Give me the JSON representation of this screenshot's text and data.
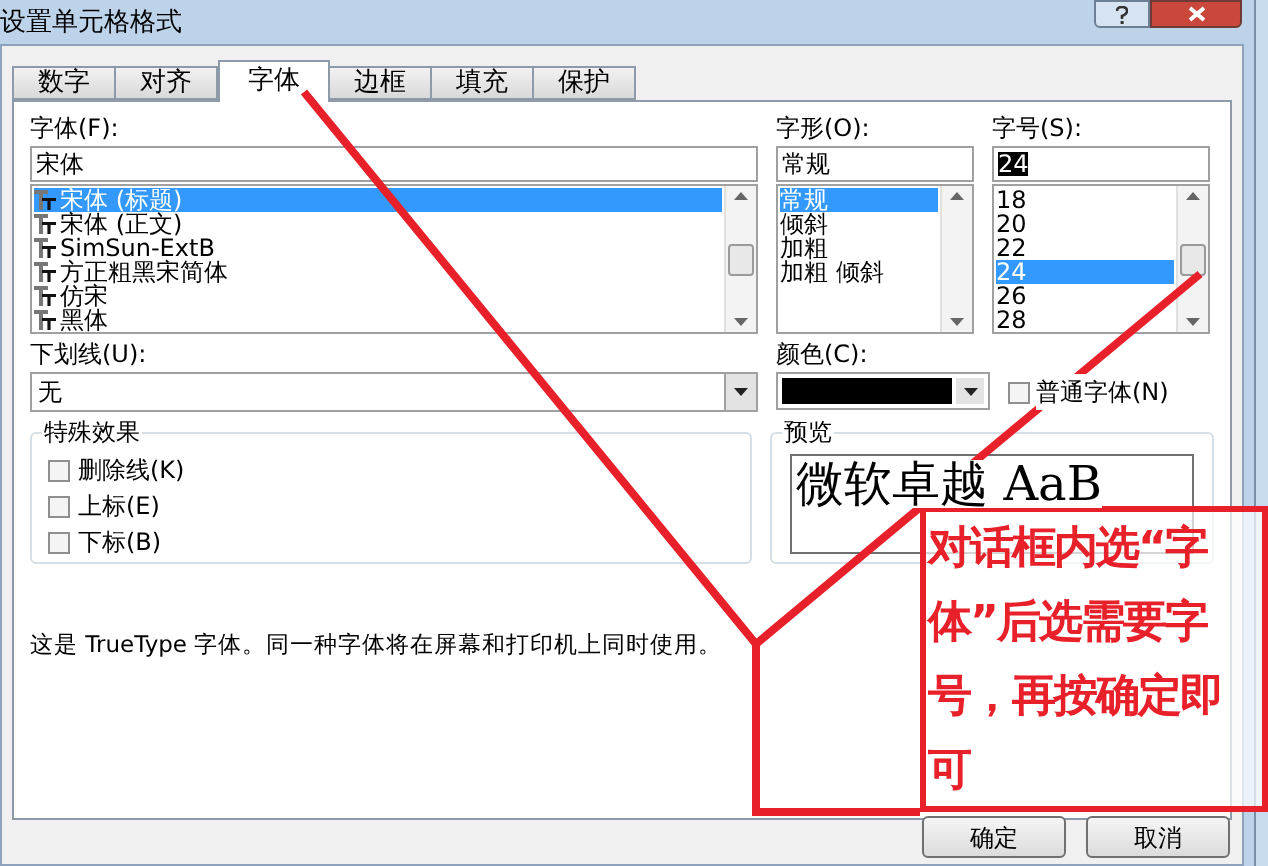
{
  "window": {
    "title": "设置单元格格式"
  },
  "tabs": [
    {
      "label": "数字",
      "selected": false
    },
    {
      "label": "对齐",
      "selected": false
    },
    {
      "label": "字体",
      "selected": true
    },
    {
      "label": "边框",
      "selected": false
    },
    {
      "label": "填充",
      "selected": false
    },
    {
      "label": "保护",
      "selected": false
    }
  ],
  "font": {
    "label": "字体(F):",
    "value": "宋体",
    "items": [
      {
        "label": "宋体 (标题)",
        "selected": true
      },
      {
        "label": "宋体 (正文)",
        "selected": false
      },
      {
        "label": "SimSun-ExtB",
        "selected": false
      },
      {
        "label": "方正粗黑宋简体",
        "selected": false
      },
      {
        "label": "仿宋",
        "selected": false
      },
      {
        "label": "黑体",
        "selected": false
      }
    ]
  },
  "style": {
    "label": "字形(O):",
    "value": "常规",
    "items": [
      {
        "label": "常规",
        "selected": true
      },
      {
        "label": "倾斜",
        "selected": false
      },
      {
        "label": "加粗",
        "selected": false
      },
      {
        "label": "加粗 倾斜",
        "selected": false
      }
    ]
  },
  "size": {
    "label": "字号(S):",
    "value": "24",
    "items": [
      {
        "label": "18",
        "selected": false
      },
      {
        "label": "20",
        "selected": false
      },
      {
        "label": "22",
        "selected": false
      },
      {
        "label": "24",
        "selected": true
      },
      {
        "label": "26",
        "selected": false
      },
      {
        "label": "28",
        "selected": false
      }
    ]
  },
  "underline": {
    "label": "下划线(U):",
    "value": "无"
  },
  "color": {
    "label": "颜色(C):",
    "color": "#000000"
  },
  "normal_font": {
    "label": "普通字体(N)",
    "checked": false
  },
  "effects": {
    "title": "特殊效果",
    "items": [
      {
        "label": "删除线(K)",
        "checked": false
      },
      {
        "label": "上标(E)",
        "checked": false
      },
      {
        "label": "下标(B)",
        "checked": false
      }
    ]
  },
  "preview": {
    "title": "预览",
    "text": "微软卓越 AaB"
  },
  "description": "这是 TrueType 字体。同一种字体将在屏幕和打印机上同时使用。",
  "buttons": [
    "确定",
    "取消"
  ],
  "annotation": {
    "text": "对话框内选“字体”后选需要字号，再按确定即可"
  }
}
